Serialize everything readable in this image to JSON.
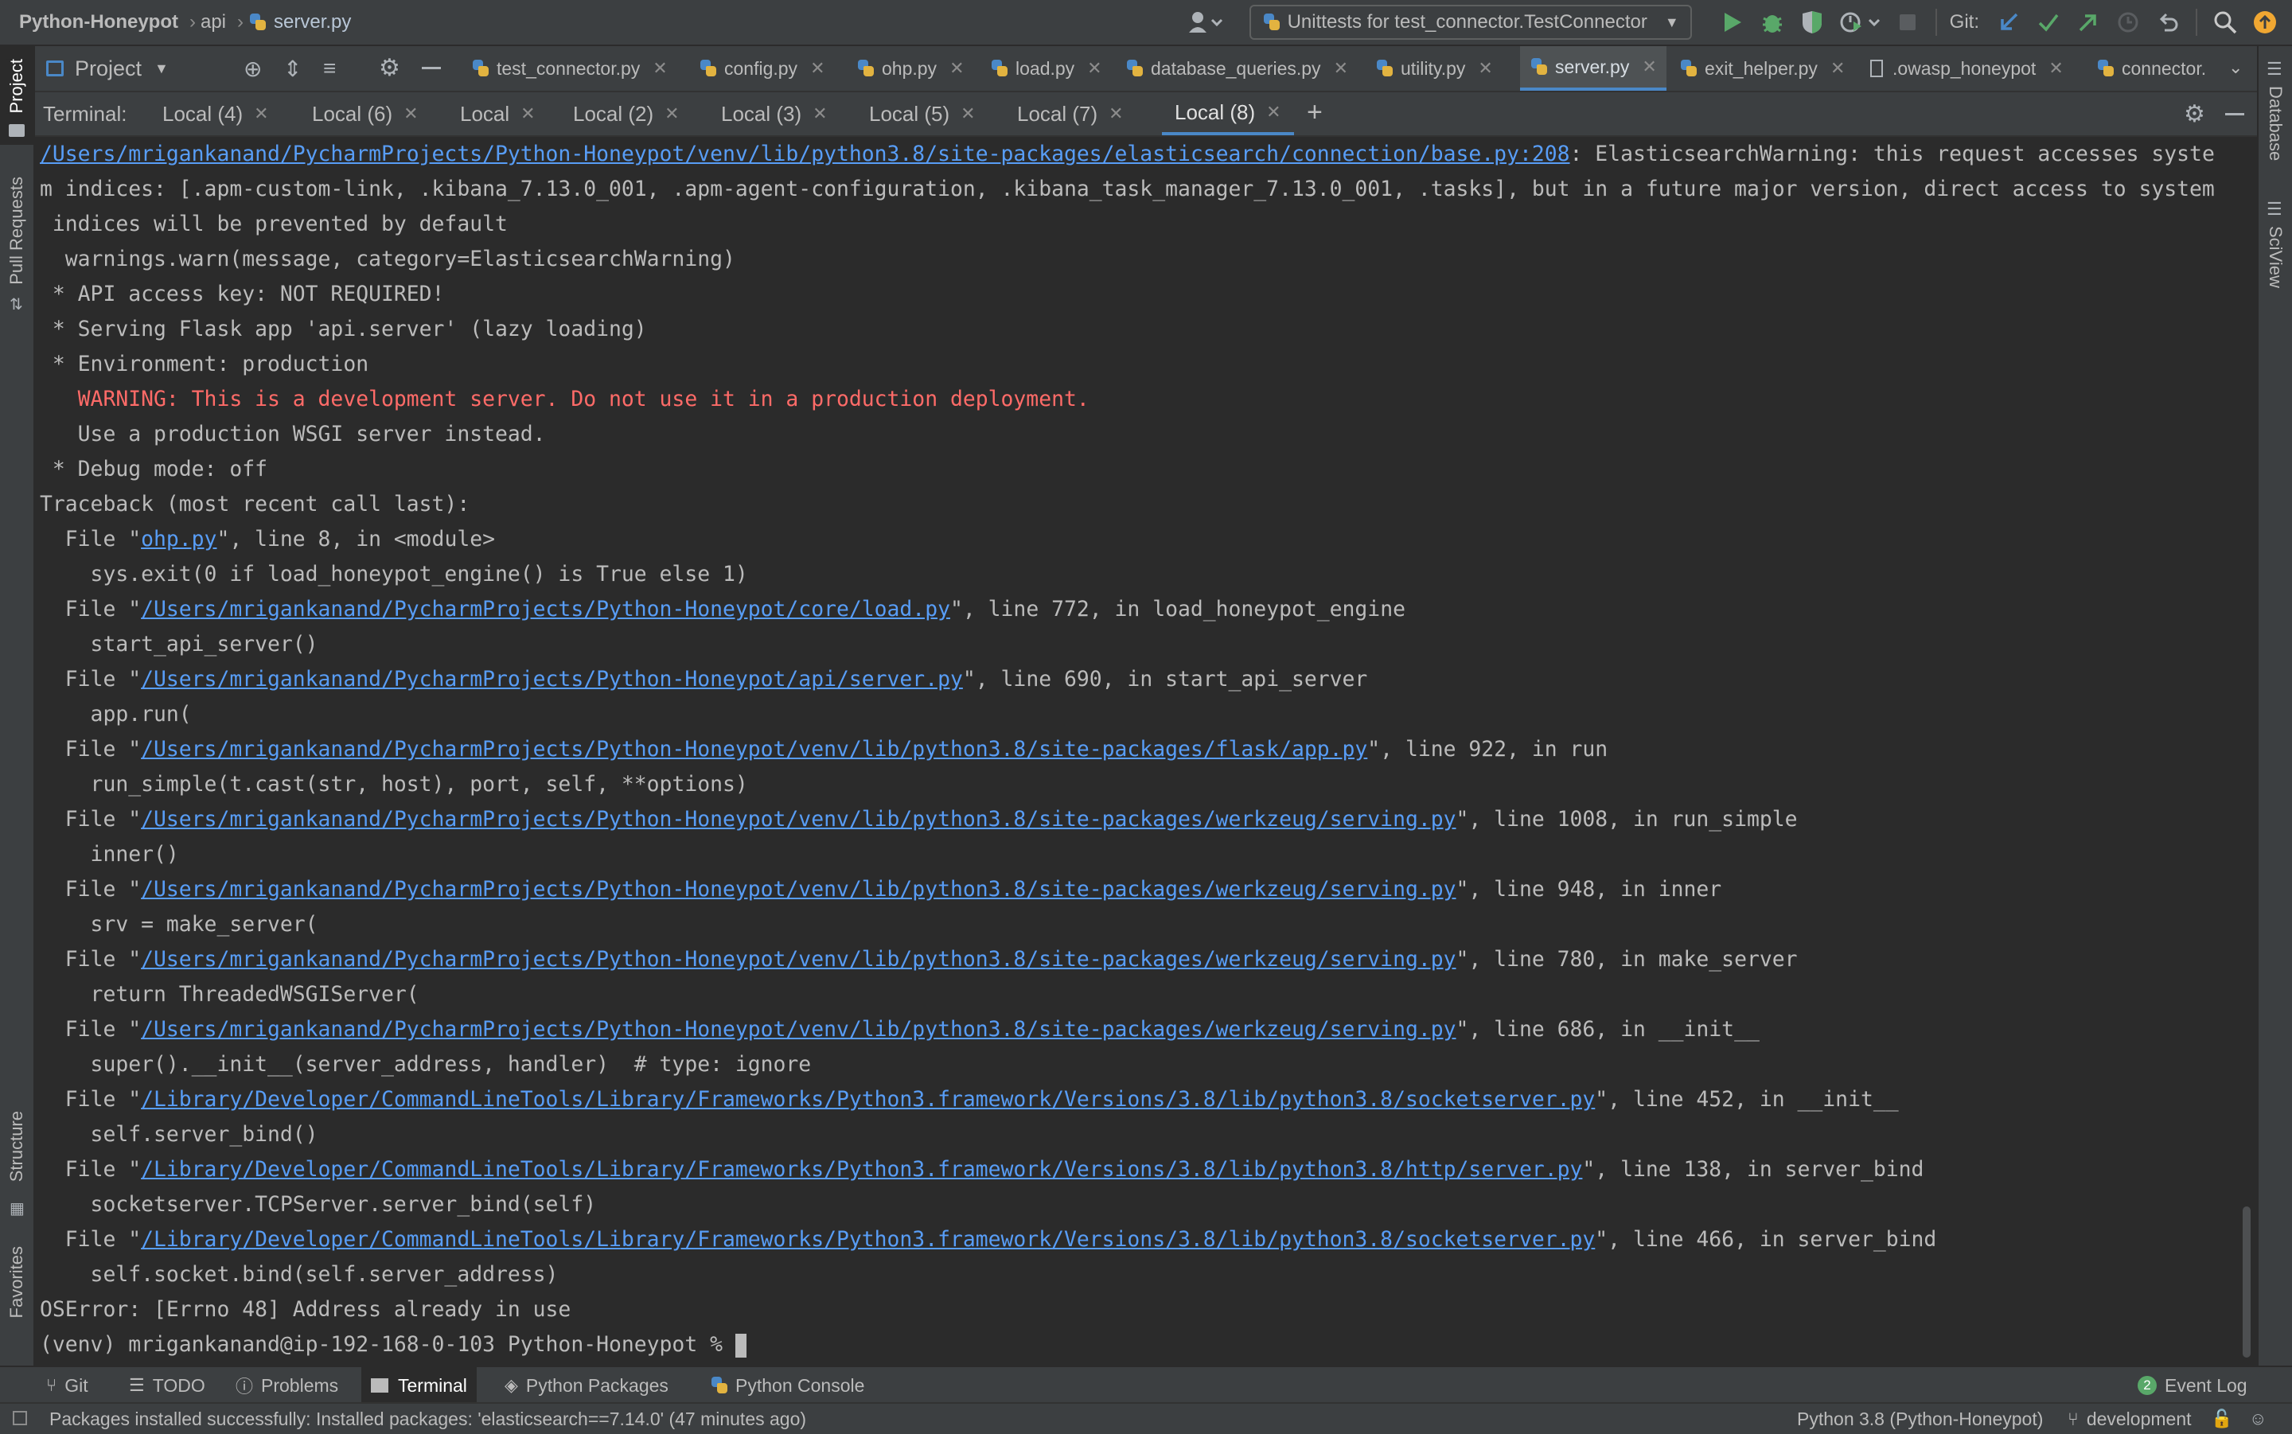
{
  "colors": {
    "accent": "#4a88c7",
    "link": "#589df6",
    "warning": "#ff6b68",
    "run_green": "#59a869",
    "background": "#2b2b2b",
    "panel": "#3c3f41"
  },
  "navbar": {
    "project": "Python-Honeypot",
    "folder": "api",
    "file": "server.py",
    "run_config": "Unittests for test_connector.TestConnector",
    "git_label": "Git:"
  },
  "left_tools": [
    "Project",
    "Pull Requests",
    "Structure",
    "Favorites"
  ],
  "right_tools": [
    "Database",
    "SciView"
  ],
  "project_pane": {
    "label": "Project"
  },
  "editor_tabs": [
    "test_connector.py",
    "config.py",
    "ohp.py",
    "load.py",
    "database_queries.py",
    "utility.py",
    "server.py",
    "exit_helper.py",
    ".owasp_honeypot",
    "connector."
  ],
  "active_editor_tab": "server.py",
  "terminal": {
    "label": "Terminal:",
    "tabs": [
      "Local (4)",
      "Local (6)",
      "Local",
      "Local (2)",
      "Local (3)",
      "Local (5)",
      "Local (7)",
      "Local (8)"
    ],
    "active_tab": "Local (8)",
    "lines": {
      "l01_link": "/Users/mrigankanand/PycharmProjects/Python-Honeypot/venv/lib/python3.8/site-packages/elasticsearch/connection/base.py:208",
      "l01_text": ": ElasticsearchWarning: this request accesses syste",
      "l02": "m indices: [.apm-custom-link, .kibana_7.13.0_001, .apm-agent-configuration, .kibana_task_manager_7.13.0_001, .tasks], but in a future major version, direct access to system",
      "l03": " indices will be prevented by default",
      "l04": "  warnings.warn(message, category=ElasticsearchWarning)",
      "l05": " * API access key: NOT REQUIRED!",
      "l06": " * Serving Flask app 'api.server' (lazy loading)",
      "l07": " * Environment: production",
      "l08": "   WARNING: This is a development server. Do not use it in a production deployment.",
      "l09": "   Use a production WSGI server instead.",
      "l10": " * Debug mode: off",
      "l11": "Traceback (most recent call last):",
      "f01_path": "ohp.py",
      "f01_rest": "\", line 8, in <module>",
      "c01": "    sys.exit(0 if load_honeypot_engine() is True else 1)",
      "f02_path": "/Users/mrigankanand/PycharmProjects/Python-Honeypot/core/load.py",
      "f02_rest": "\", line 772, in load_honeypot_engine",
      "c02": "    start_api_server()",
      "f03_path": "/Users/mrigankanand/PycharmProjects/Python-Honeypot/api/server.py",
      "f03_rest": "\", line 690, in start_api_server",
      "c03": "    app.run(",
      "f04_path": "/Users/mrigankanand/PycharmProjects/Python-Honeypot/venv/lib/python3.8/site-packages/flask/app.py",
      "f04_rest": "\", line 922, in run",
      "c04": "    run_simple(t.cast(str, host), port, self, **options)",
      "f05_path": "/Users/mrigankanand/PycharmProjects/Python-Honeypot/venv/lib/python3.8/site-packages/werkzeug/serving.py",
      "f05_rest": "\", line 1008, in run_simple",
      "c05": "    inner()",
      "f06_path": "/Users/mrigankanand/PycharmProjects/Python-Honeypot/venv/lib/python3.8/site-packages/werkzeug/serving.py",
      "f06_rest": "\", line 948, in inner",
      "c06": "    srv = make_server(",
      "f07_path": "/Users/mrigankanand/PycharmProjects/Python-Honeypot/venv/lib/python3.8/site-packages/werkzeug/serving.py",
      "f07_rest": "\", line 780, in make_server",
      "c07": "    return ThreadedWSGIServer(",
      "f08_path": "/Users/mrigankanand/PycharmProjects/Python-Honeypot/venv/lib/python3.8/site-packages/werkzeug/serving.py",
      "f08_rest": "\", line 686, in __init__",
      "c08": "    super().__init__(server_address, handler)  # type: ignore",
      "f09_path": "/Library/Developer/CommandLineTools/Library/Frameworks/Python3.framework/Versions/3.8/lib/python3.8/socketserver.py",
      "f09_rest": "\", line 452, in __init__",
      "c09": "    self.server_bind()",
      "f10_path": "/Library/Developer/CommandLineTools/Library/Frameworks/Python3.framework/Versions/3.8/lib/python3.8/http/server.py",
      "f10_rest": "\", line 138, in server_bind",
      "c10": "    socketserver.TCPServer.server_bind(self)",
      "f11_path": "/Library/Developer/CommandLineTools/Library/Frameworks/Python3.framework/Versions/3.8/lib/python3.8/socketserver.py",
      "f11_rest": "\", line 466, in server_bind",
      "c11": "    self.socket.bind(self.server_address)",
      "err": "OSError: [Errno 48] Address already in use",
      "prompt": "(venv) mrigankanand@ip-192-168-0-103 Python-Honeypot % "
    },
    "file_prefix": "  File \""
  },
  "tool_windows": {
    "git": "Git",
    "todo": "TODO",
    "problems": "Problems",
    "terminal": "Terminal",
    "python_packages": "Python Packages",
    "python_console": "Python Console",
    "event_log": "Event Log",
    "event_count": "2"
  },
  "status": {
    "message": "Packages installed successfully: Installed packages: 'elasticsearch==7.14.0' (47 minutes ago)",
    "interpreter": "Python 3.8 (Python-Honeypot)",
    "branch": "development"
  }
}
